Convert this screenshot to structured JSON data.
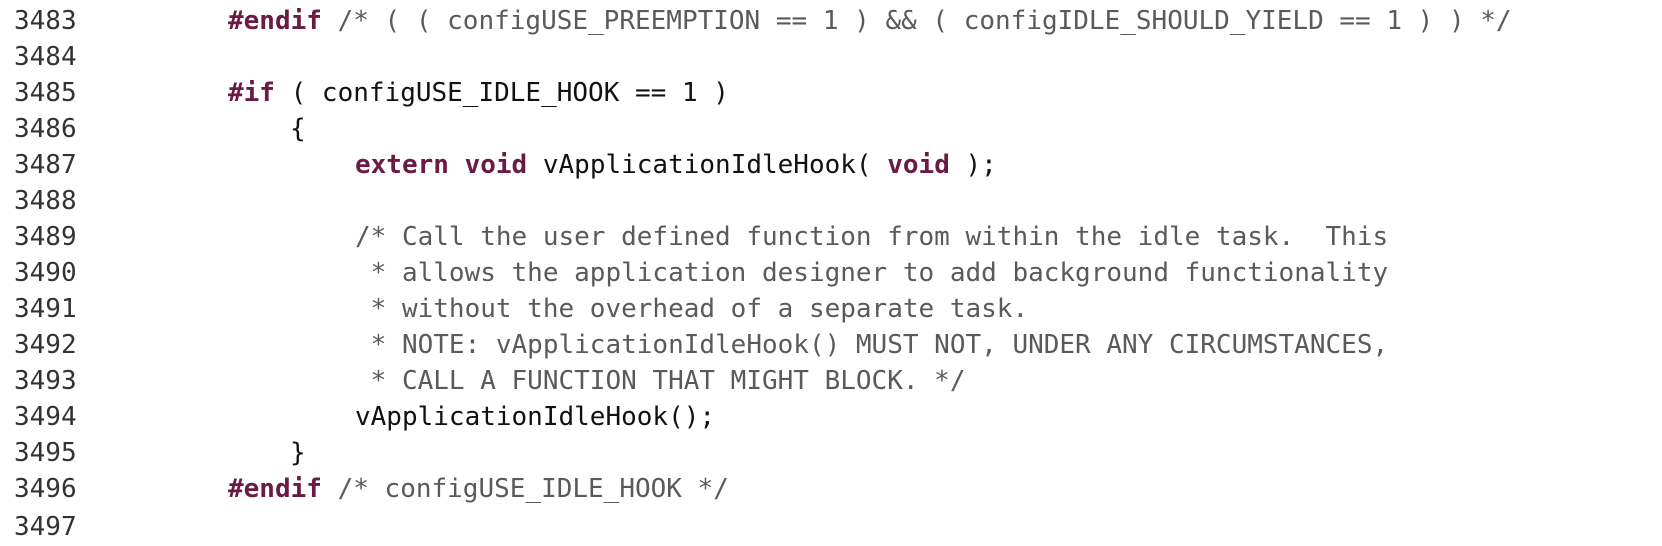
{
  "editor": {
    "background": "#ffffff",
    "keyword_color": "#6b1a45",
    "comment_color": "#5a5a5a",
    "text_color": "#111111"
  },
  "lines": [
    {
      "number": "3483",
      "tokens": [
        {
          "kind": "keyword",
          "text": "#endif"
        },
        {
          "kind": "comment",
          "text": " /* ( ( configUSE_PREEMPTION == 1 ) && ( configIDLE_SHOULD_YIELD == 1 ) ) */"
        }
      ]
    },
    {
      "number": "3484",
      "tokens": []
    },
    {
      "number": "3485",
      "tokens": [
        {
          "kind": "keyword",
          "text": "#if"
        },
        {
          "kind": "text",
          "text": " ( configUSE_IDLE_HOOK == 1 )"
        }
      ]
    },
    {
      "number": "3486",
      "tokens": [
        {
          "kind": "text",
          "text": "{"
        }
      ]
    },
    {
      "number": "3487",
      "tokens": [
        {
          "kind": "keyword",
          "text": "extern"
        },
        {
          "kind": "text",
          "text": " "
        },
        {
          "kind": "keyword",
          "text": "void"
        },
        {
          "kind": "text",
          "text": " vApplicationIdleHook( "
        },
        {
          "kind": "keyword",
          "text": "void"
        },
        {
          "kind": "text",
          "text": " );"
        }
      ]
    },
    {
      "number": "3488",
      "tokens": []
    },
    {
      "number": "3489",
      "tokens": [
        {
          "kind": "comment",
          "text": "/* Call the user defined function from within the idle task.  This"
        }
      ]
    },
    {
      "number": "3490",
      "tokens": [
        {
          "kind": "comment",
          "text": " * allows the application designer to add background functionality"
        }
      ]
    },
    {
      "number": "3491",
      "tokens": [
        {
          "kind": "comment",
          "text": " * without the overhead of a separate task."
        }
      ]
    },
    {
      "number": "3492",
      "tokens": [
        {
          "kind": "comment",
          "text": " * NOTE: vApplicationIdleHook() MUST NOT, UNDER ANY CIRCUMSTANCES,"
        }
      ]
    },
    {
      "number": "3493",
      "tokens": [
        {
          "kind": "comment",
          "text": " * CALL A FUNCTION THAT MIGHT BLOCK. */"
        }
      ]
    },
    {
      "number": "3494",
      "tokens": [
        {
          "kind": "text",
          "text": "vApplicationIdleHook();"
        }
      ]
    },
    {
      "number": "3495",
      "tokens": [
        {
          "kind": "text",
          "text": "}"
        }
      ]
    },
    {
      "number": "3496",
      "tokens": [
        {
          "kind": "keyword",
          "text": "#endif"
        },
        {
          "kind": "comment",
          "text": " /* configUSE_IDLE_HOOK */"
        }
      ]
    },
    {
      "number": "3497",
      "tokens": []
    }
  ]
}
